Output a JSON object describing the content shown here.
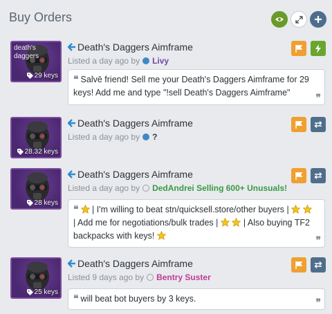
{
  "header": {
    "title": "Buy Orders"
  },
  "orders": [
    {
      "item_label": "death's daggers",
      "price": "29 keys",
      "name": "Death's Daggers Aimframe",
      "listed_prefix": "Listed a day ago by",
      "user": "Livy",
      "user_color": "#6e4aaa",
      "online": true,
      "message": "Salvē friend! Sell me your Death's Daggers Aimframe for 29 keys! Add me and type \"!sell Death's Daggers Aimframe\"",
      "action": "bolt"
    },
    {
      "item_label": "",
      "price": "28.32 keys",
      "name": "Death's Daggers Aimframe",
      "listed_prefix": "Listed a day ago by",
      "user": "?",
      "user_color": "#3a3f44",
      "online": true,
      "message": "",
      "action": "swap"
    },
    {
      "item_label": "",
      "price": "28 keys",
      "name": "Death's Daggers Aimframe",
      "listed_prefix": "Listed a day ago by",
      "user": "DedAndrei Selling 600+ Unusuals!",
      "user_color": "#3a9a45",
      "online": false,
      "message_parts": [
        "| I'm willing to beat stn/quicksell.store/other buyers |",
        "| Add me for negotiations/bulk trades |",
        "| Also buying TF2 backpacks with keys!"
      ],
      "action": "swap"
    },
    {
      "item_label": "",
      "price": "25 keys",
      "name": "Death's Daggers Aimframe",
      "listed_prefix": "Listed 9 days ago by",
      "user": "Bentry Suster",
      "user_color": "#c0399a",
      "online": false,
      "message": "will beat bot buyers by 3 keys.",
      "action": "swap"
    }
  ],
  "icons": {
    "visibility": "eye-icon",
    "expand": "expand-icon",
    "add": "plus-icon",
    "flag": "flag-icon",
    "bolt": "lightning-icon",
    "swap": "swap-arrows-icon",
    "tag": "tag-icon",
    "back": "arrow-left-icon",
    "star": "star-icon"
  },
  "colors": {
    "background": "#e8eaed",
    "flag": "#f0a030",
    "bolt": "#6aa52d",
    "swap": "#4f6e8b",
    "unusual_border": "#7d4a9e",
    "link": "#2f8ad0"
  }
}
